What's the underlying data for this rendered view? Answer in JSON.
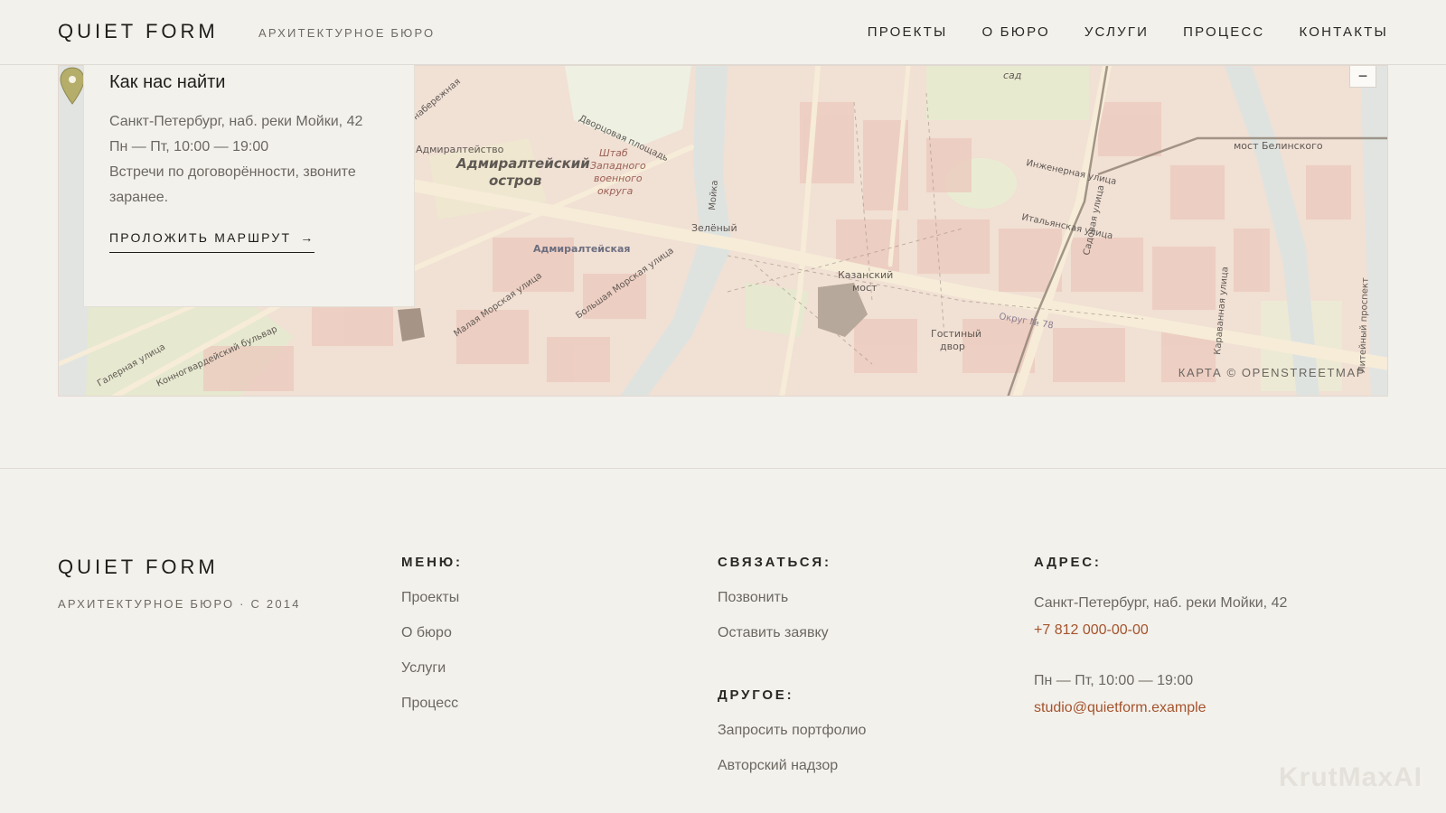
{
  "header": {
    "logo": "QUIET FORM",
    "tagline": "АРХИТЕКТУРНОЕ БЮРО",
    "nav": [
      "ПРОЕКТЫ",
      "О БЮРО",
      "УСЛУГИ",
      "ПРОЦЕСС",
      "КОНТАКТЫ"
    ]
  },
  "map": {
    "zoom_out": "−",
    "attribution": "КАРТА © OPENSTREETMAP",
    "labels": {
      "island": "Адмиралтейский",
      "island2": "остров",
      "admiralty": "Адмиралтейство",
      "shtab": "Штаб",
      "shtab2": "Западного",
      "shtab3": "военного",
      "shtab4": "округа",
      "dvor": "Дворцовая площадь",
      "admiralteyskaya": "Адмиралтейская",
      "zeleny": "Зелёный",
      "kazansky": "Казанский",
      "kazansky2": "мост",
      "gostiny": "Гостиный",
      "gostiny2": "двор",
      "belinsky": "мост Белинского",
      "inzhenernaya": "Инженерная улица",
      "italyanskaya": "Итальянская улица",
      "sadovaya": "Садовая улица",
      "moika": "Мойка",
      "bolshaya_morskaya": "Большая Морская улица",
      "malaya_morskaya": "Малая Морская улица",
      "konnogvard": "Конногвардейский бульвар",
      "galernaya": "Галерная улица",
      "karavannaya": "Караванная улица",
      "liteyny": "Литейный проспект",
      "okrug": "Округ № 78",
      "sad": "сад",
      "naberezh": "набережная"
    }
  },
  "card": {
    "title": "Как нас найти",
    "address": "Санкт-Петербург, наб. реки Мойки, 42",
    "hours": "Пн — Пт, 10:00 — 19:00",
    "note": "Встречи по договорённости, звоните заранее.",
    "route_label": "ПРОЛОЖИТЬ МАРШРУТ",
    "route_arrow": "→"
  },
  "footer": {
    "logo": "QUIET FORM",
    "sub": "АРХИТЕКТУРНОЕ БЮРО · С 2014",
    "menu": {
      "title": "МЕНЮ:",
      "items": [
        "Проекты",
        "О бюро",
        "Услуги",
        "Процесс"
      ]
    },
    "contact": {
      "title": "СВЯЗАТЬСЯ:",
      "items": [
        "Позвонить",
        "Оставить заявку"
      ]
    },
    "other": {
      "title": "ДРУГОЕ:",
      "items": [
        "Запросить портфолио",
        "Авторский надзор"
      ]
    },
    "address": {
      "title": "АДРЕС:",
      "line": "Санкт-Петербург, наб. реки Мойки, 42",
      "phone": "+7 812 000-00-00",
      "hours": "Пн — Пт, 10:00 — 19:00",
      "email": "studio@quietform.example"
    }
  },
  "watermark": "KrutMaxAI",
  "colors": {
    "accent": "#a4542d",
    "background": "#f3f1ec"
  }
}
